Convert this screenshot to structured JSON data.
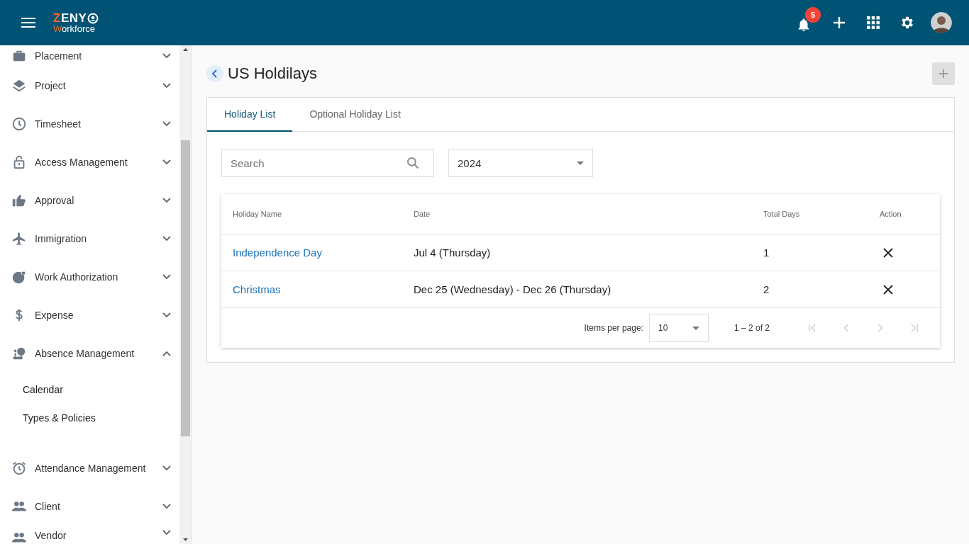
{
  "header": {
    "logo": {
      "line1": "ZENY",
      "line2": "Workforce"
    },
    "notifications": "5"
  },
  "sidebar": {
    "items": [
      {
        "label": "Placement",
        "kind": "briefcase",
        "expanded": false
      },
      {
        "label": "Project",
        "kind": "layers",
        "expanded": false
      },
      {
        "label": "Timesheet",
        "kind": "clock",
        "expanded": false
      },
      {
        "label": "Access Management",
        "kind": "lock",
        "expanded": false
      },
      {
        "label": "Approval",
        "kind": "thumb",
        "expanded": false
      },
      {
        "label": "Immigration",
        "kind": "plane",
        "expanded": false
      },
      {
        "label": "Work Authorization",
        "kind": "globe",
        "expanded": false
      },
      {
        "label": "Expense",
        "kind": "dollar",
        "expanded": false
      },
      {
        "label": "Absence Management",
        "kind": "tree",
        "expanded": true,
        "children": [
          {
            "label": "Calendar"
          },
          {
            "label": "Types & Policies"
          }
        ]
      },
      {
        "label": "Attendance Management",
        "kind": "alarm",
        "expanded": false
      },
      {
        "label": "Client",
        "kind": "people",
        "expanded": false
      },
      {
        "label": "Vendor",
        "kind": "people",
        "expanded": false
      }
    ]
  },
  "page": {
    "title": "US Holdilays"
  },
  "tabs": [
    {
      "label": "Holiday List",
      "selected": true
    },
    {
      "label": "Optional Holiday List",
      "selected": false
    }
  ],
  "search": {
    "placeholder": "Search"
  },
  "year_select": {
    "value": "2024"
  },
  "table": {
    "columns": [
      "Holiday Name",
      "Date",
      "Total Days",
      "Action"
    ],
    "rows": [
      {
        "name": "Independence Day",
        "date": "Jul 4 (Thursday)",
        "total_days": "1"
      },
      {
        "name": "Christmas",
        "date": "Dec 25 (Wednesday) - Dec 26 (Thursday)",
        "total_days": "2"
      }
    ]
  },
  "paginator": {
    "label": "Items per page:",
    "page_size": "10",
    "range": "1 – 2 of 2",
    "buttons": [
      {
        "kind": "first",
        "disabled": true
      },
      {
        "kind": "prev",
        "disabled": true
      },
      {
        "kind": "next",
        "disabled": true
      },
      {
        "kind": "last",
        "disabled": true
      }
    ]
  }
}
